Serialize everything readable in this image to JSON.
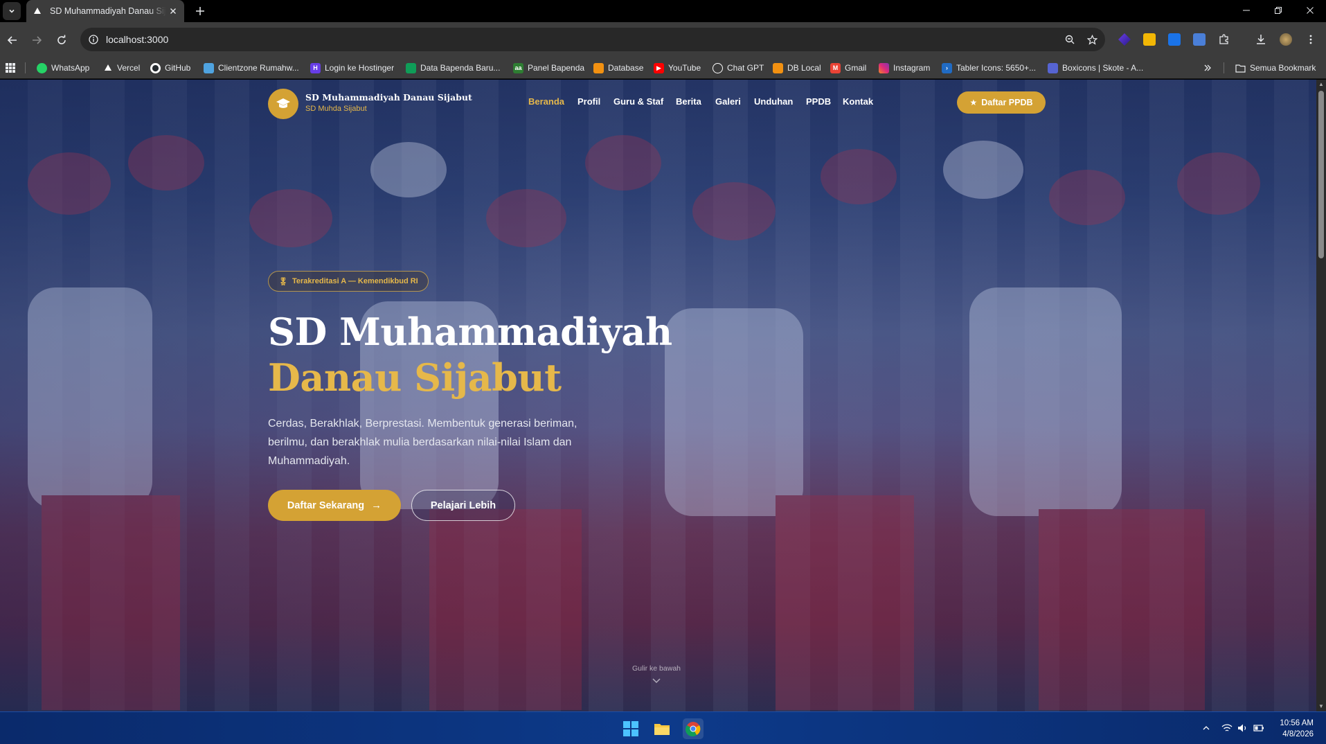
{
  "browser": {
    "tab_title": "SD Muhammadiyah Danau Sijabut",
    "url": "localhost:3000",
    "bookmarks": [
      {
        "label": "WhatsApp",
        "icon": "whatsapp-icon",
        "color": "#25d366"
      },
      {
        "label": "Vercel",
        "icon": "vercel-icon",
        "color": "#000000"
      },
      {
        "label": "GitHub",
        "icon": "github-icon",
        "color": "#000000"
      },
      {
        "label": "Clientzone Rumahw...",
        "icon": "rumahweb-icon",
        "color": "#4fa3e0"
      },
      {
        "label": "Login ke Hostinger",
        "icon": "hostinger-icon",
        "color": "#673de6"
      },
      {
        "label": "Data Bapenda Baru...",
        "icon": "sheets-icon",
        "color": "#0f9d58"
      },
      {
        "label": "Panel Bapenda",
        "icon": "panel-icon",
        "color": "#2e7d32"
      },
      {
        "label": "Database",
        "icon": "database-icon",
        "color": "#f29111"
      },
      {
        "label": "YouTube",
        "icon": "youtube-icon",
        "color": "#ff0000"
      },
      {
        "label": "Chat GPT",
        "icon": "chatgpt-icon",
        "color": "#ffffff"
      },
      {
        "label": "DB Local",
        "icon": "db-local-icon",
        "color": "#f29111"
      },
      {
        "label": "Gmail",
        "icon": "gmail-icon",
        "color": "#ea4335"
      },
      {
        "label": "Instagram",
        "icon": "instagram-icon",
        "color": "#e1306c"
      },
      {
        "label": "Tabler Icons: 5650+...",
        "icon": "tabler-icon",
        "color": "#206bc4"
      },
      {
        "label": "Boxicons | Skote - A...",
        "icon": "boxicons-icon",
        "color": "#5664d2"
      }
    ],
    "all_bookmarks": "Semua Bookmark"
  },
  "site": {
    "brand_title": "SD Muhammadiyah Danau Sijabut",
    "brand_subtitle": "SD Muhda Sijabut",
    "nav": [
      "Beranda",
      "Profil",
      "Guru & Staf",
      "Berita",
      "Galeri",
      "Unduhan",
      "PPDB",
      "Kontak"
    ],
    "nav_active": "Beranda",
    "cta": "Daftar PPDB",
    "accent": "#d4a234",
    "accent_text": "#e6b84a"
  },
  "hero": {
    "badge": "Terakreditasi A — Kemendikbud RI",
    "title_line1": "SD Muhammadiyah",
    "title_line2": "Danau Sijabut",
    "description": "Cerdas, Berakhlak, Berprestasi. Membentuk generasi beriman, berilmu, dan berakhlak mulia berdasarkan nilai-nilai Islam dan Muhammadiyah.",
    "primary_button": "Daftar Sekarang",
    "secondary_button": "Pelajari Lebih",
    "scroll_hint": "Gulir ke bawah"
  },
  "taskbar": {
    "time": "10:56 AM",
    "date": "4/8/2026"
  }
}
